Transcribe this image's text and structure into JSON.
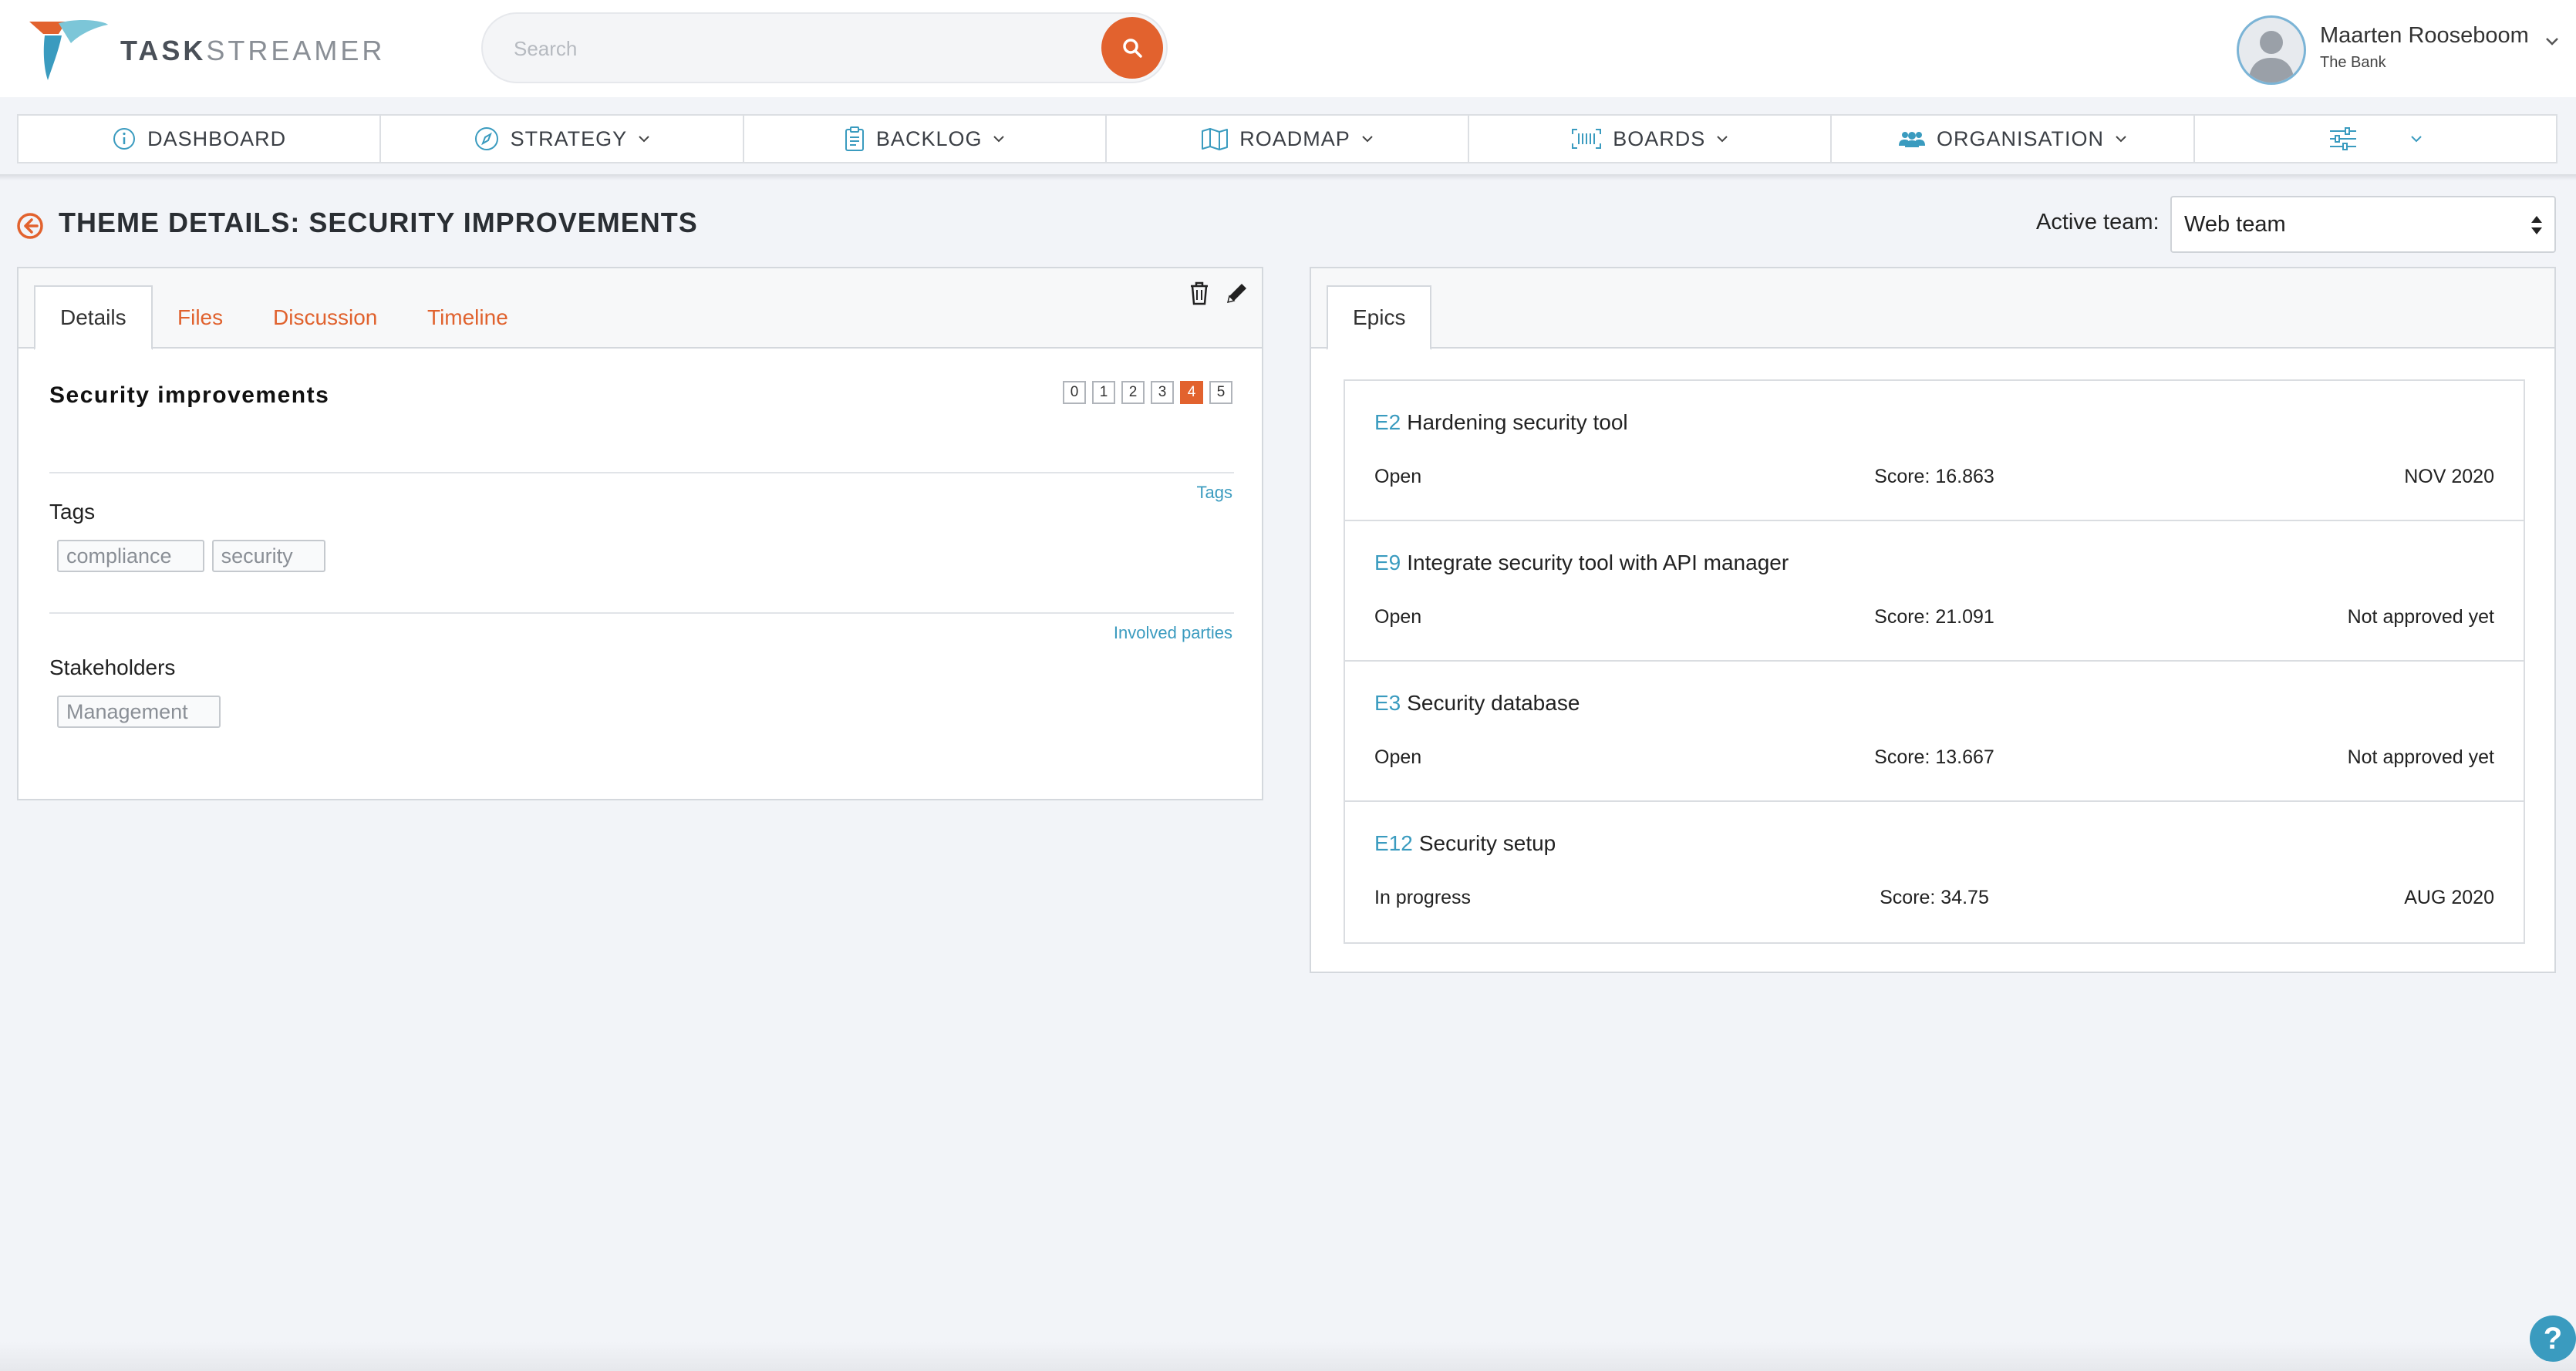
{
  "brand": {
    "name_bold": "TASK",
    "name_light": "STREAMER",
    "colors": {
      "accent": "#e2622e",
      "link": "#3a9bbf"
    }
  },
  "search": {
    "placeholder": "Search",
    "icon": "search-icon"
  },
  "user": {
    "name": "Maarten Rooseboom",
    "organisation": "The Bank"
  },
  "nav": {
    "items": [
      {
        "label": "DASHBOARD",
        "icon": "info-icon"
      },
      {
        "label": "STRATEGY",
        "icon": "compass-icon"
      },
      {
        "label": "BACKLOG",
        "icon": "clipboard-icon"
      },
      {
        "label": "ROADMAP",
        "icon": "map-icon"
      },
      {
        "label": "BOARDS",
        "icon": "barcode-icon"
      },
      {
        "label": "ORGANISATION",
        "icon": "users-icon"
      },
      {
        "label": "",
        "icon": "sliders-icon"
      }
    ]
  },
  "page": {
    "title": "THEME DETAILS: SECURITY IMPROVEMENTS",
    "active_team_label": "Active team:",
    "active_team_value": "Web team"
  },
  "details": {
    "tabs": [
      "Details",
      "Files",
      "Discussion",
      "Timeline"
    ],
    "active_tab": "Details",
    "theme_name": "Security improvements",
    "score_options": [
      "0",
      "1",
      "2",
      "3",
      "4",
      "5"
    ],
    "selected_score": "4",
    "tags_link": "Tags",
    "tags_title": "Tags",
    "tags": [
      "compliance",
      "security"
    ],
    "parties_link": "Involved parties",
    "stakeholders_title": "Stakeholders",
    "stakeholders": [
      "Management"
    ]
  },
  "epics": {
    "tab": "Epics",
    "items": [
      {
        "code": "E2",
        "title": "Hardening security tool",
        "status": "Open",
        "score": "Score: 16.863",
        "date": "NOV 2020"
      },
      {
        "code": "E9",
        "title": "Integrate security tool with API manager",
        "status": "Open",
        "score": "Score: 21.091",
        "date": "Not approved yet"
      },
      {
        "code": "E3",
        "title": "Security database",
        "status": "Open",
        "score": "Score: 13.667",
        "date": "Not approved yet"
      },
      {
        "code": "E12",
        "title": "Security setup",
        "status": "In progress",
        "score": "Score: 34.75",
        "date": "AUG 2020"
      }
    ]
  },
  "help": {
    "label": "?"
  }
}
